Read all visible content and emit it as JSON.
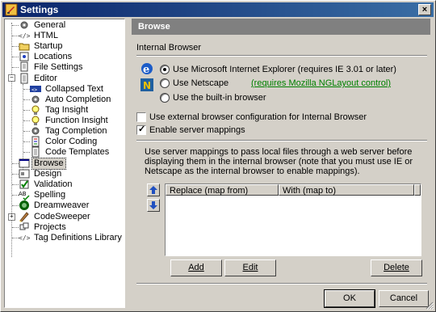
{
  "window": {
    "title": "Settings",
    "close_label": "×"
  },
  "tree": {
    "items": [
      {
        "label": "General",
        "icon": "gear-icon"
      },
      {
        "label": "HTML",
        "icon": "html-tag-icon"
      },
      {
        "label": "Startup",
        "icon": "folder-icon"
      },
      {
        "label": "Locations",
        "icon": "location-icon"
      },
      {
        "label": "File Settings",
        "icon": "file-settings-icon"
      },
      {
        "label": "Editor",
        "icon": "document-icon"
      },
      {
        "label": "Collapsed Text",
        "icon": "collapsed-text-icon"
      },
      {
        "label": "Auto Completion",
        "icon": "gear-icon"
      },
      {
        "label": "Tag Insight",
        "icon": "lightbulb-icon"
      },
      {
        "label": "Function Insight",
        "icon": "lightbulb-icon"
      },
      {
        "label": "Tag Completion",
        "icon": "gear-icon"
      },
      {
        "label": "Color Coding",
        "icon": "document-icon"
      },
      {
        "label": "Code Templates",
        "icon": "document-icon"
      },
      {
        "label": "Browse",
        "icon": "browse-icon"
      },
      {
        "label": "Design",
        "icon": "design-icon"
      },
      {
        "label": "Validation",
        "icon": "validation-icon"
      },
      {
        "label": "Spelling",
        "icon": "spelling-icon"
      },
      {
        "label": "Dreamweaver",
        "icon": "dreamweaver-icon"
      },
      {
        "label": "CodeSweeper",
        "icon": "codesweeper-icon"
      },
      {
        "label": "Projects",
        "icon": "projects-icon"
      },
      {
        "label": "Tag Definitions Library",
        "icon": "tag-library-icon"
      }
    ],
    "selected": "Browse"
  },
  "panel": {
    "title": "Browse",
    "group_label": "Internal Browser",
    "radio_ie": "Use Microsoft Internet Explorer (requires IE 3.01 or later)",
    "radio_netscape": "Use Netscape",
    "netscape_link": "(requires Mozilla NGLayout control)",
    "radio_builtin": "Use the built-in browser",
    "selected_browser": "ie",
    "check_external": "Use external browser configuration for Internal Browser",
    "check_external_value": false,
    "check_mappings": "Enable server mappings",
    "check_mappings_value": true,
    "mappings_description": "Use server mappings to pass local files through a web server before displaying them in the internal browser (note that you must use IE or Netscape as the internal browser to enable mappings).",
    "col_replace": "Replace (map from)",
    "col_with": "With (map to)",
    "add_button": "Add",
    "edit_button": "Edit",
    "delete_button": "Delete"
  },
  "footer": {
    "ok_button": "OK",
    "cancel_button": "Cancel"
  },
  "colors": {
    "title_start": "#0a246a",
    "title_end": "#3a6ea5",
    "face": "#d4d0c8",
    "header": "#808080",
    "link": "#008000"
  }
}
